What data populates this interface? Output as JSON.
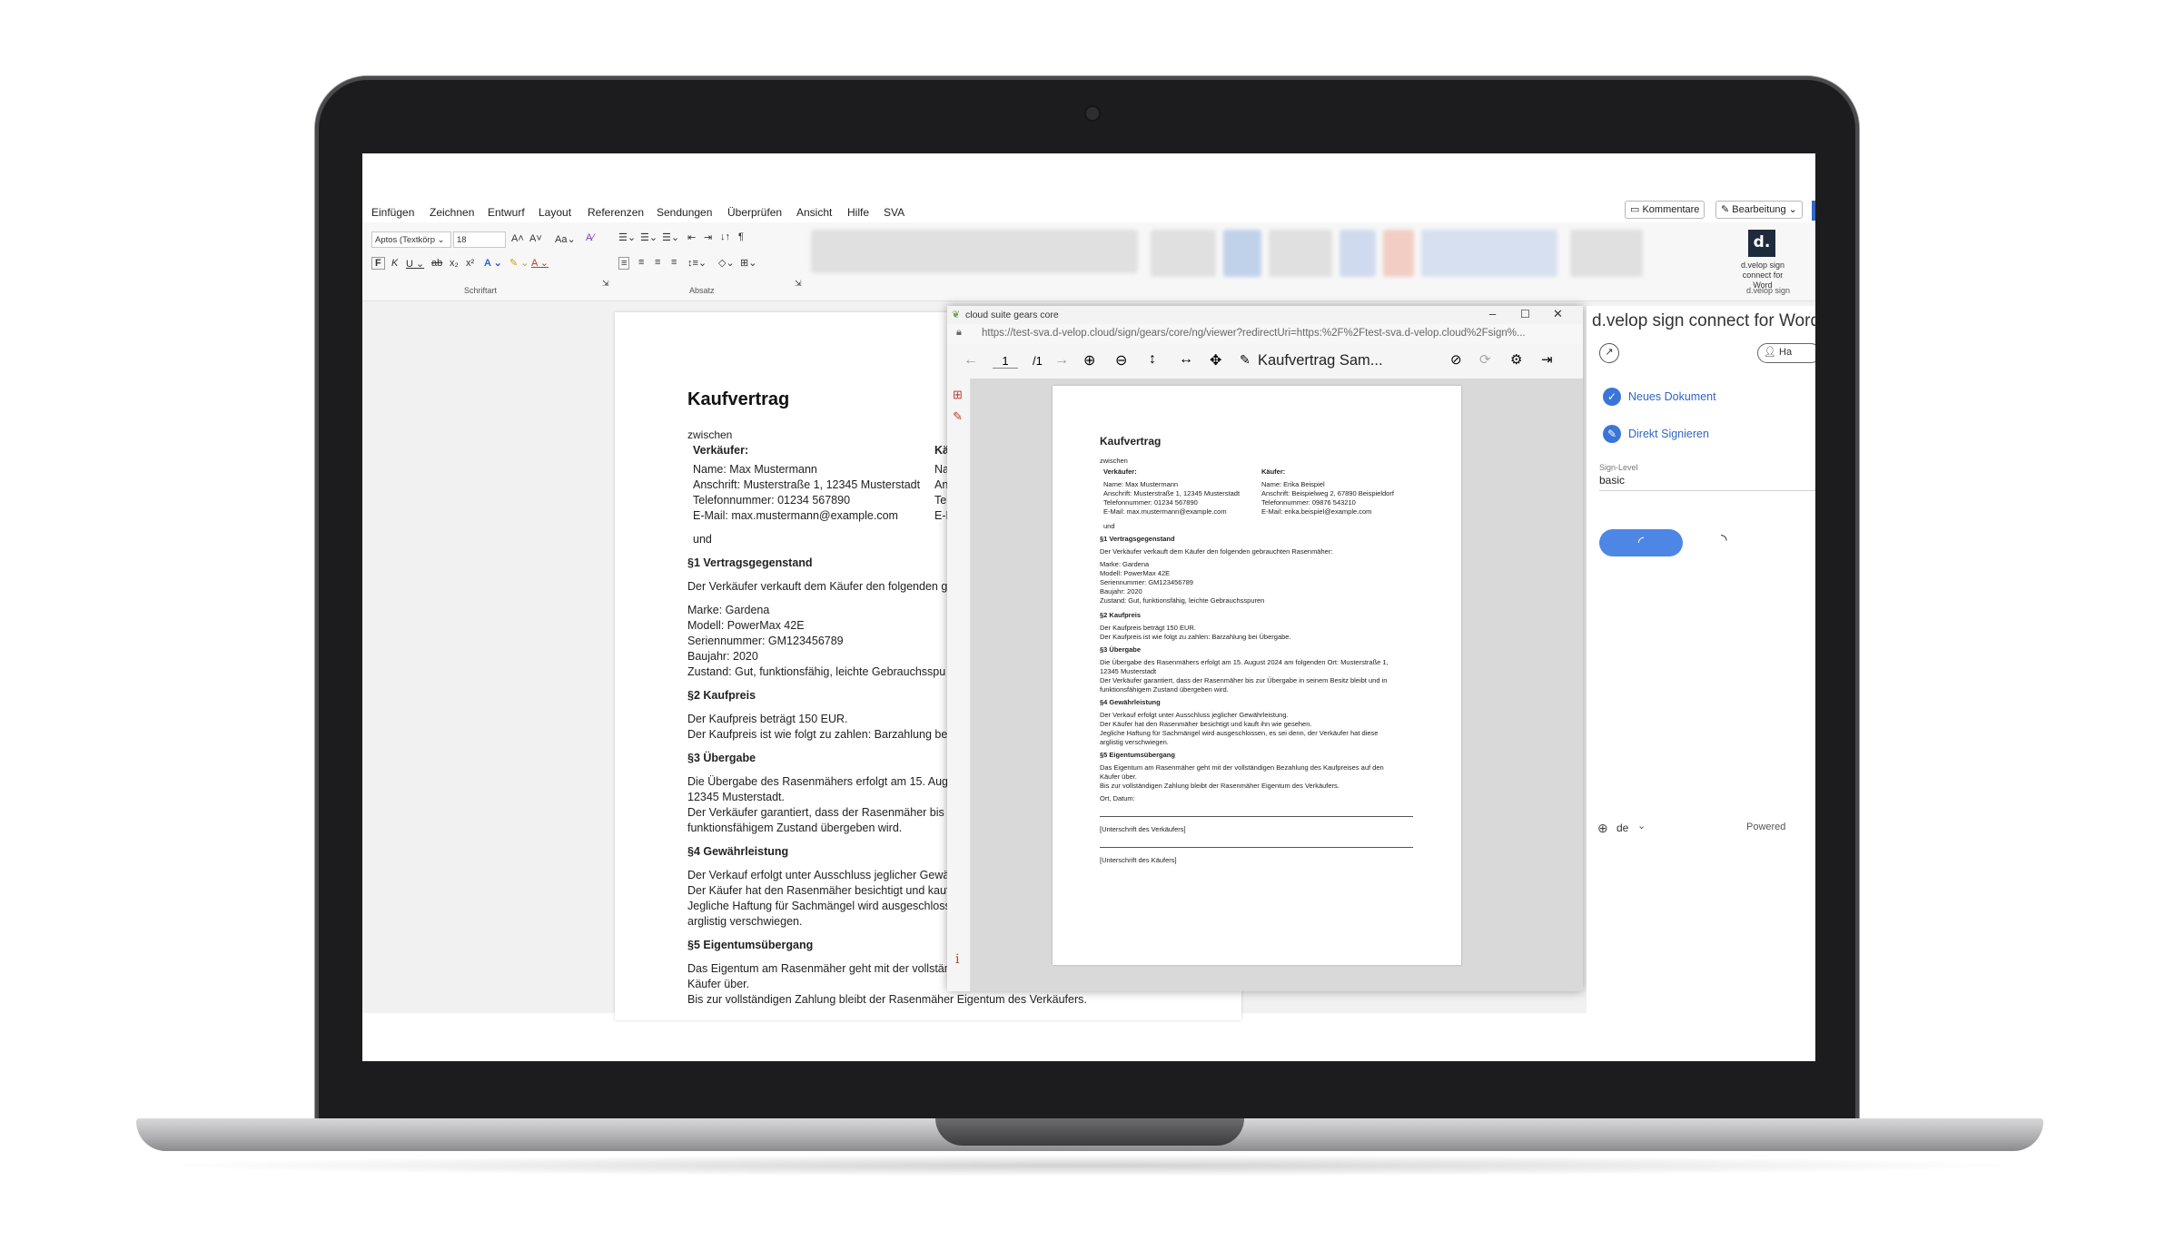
{
  "ribbon": {
    "tabs": [
      "Einfügen",
      "Zeichnen",
      "Entwurf",
      "Layout",
      "Referenzen",
      "Sendungen",
      "Überprüfen",
      "Ansicht",
      "Hilfe",
      "SVA"
    ],
    "font_name": "Aptos (Textkörp",
    "font_size": "18",
    "group_font": "Schriftart",
    "group_paragraph": "Absatz",
    "comments_label": "Kommentare",
    "edit_label": "Bearbeitung",
    "addin_label": "d.velop sign connect for Word",
    "addin_label_line1": "d.velop sign",
    "addin_label_line2": "connect for Word",
    "addin_group": "d.velop sign",
    "logo_text": "d."
  },
  "document": {
    "title": "Kaufvertrag",
    "between": "zwischen",
    "seller_heading": "Verkäufer:",
    "buyer_heading": "Kä",
    "seller_name": "Name: Max Mustermann",
    "seller_address": "Anschrift: Musterstraße 1, 12345 Musterstadt",
    "seller_phone": "Telefonnummer: 01234 567890",
    "seller_email": "E-Mail: max.mustermann@example.com",
    "buyer_cut_1": "Na",
    "buyer_cut_2": "An",
    "buyer_cut_3": "Tel",
    "buyer_cut_4": "E-M",
    "and": "und",
    "s1_title": "§1 Vertragsgegenstand",
    "s1_text": "Der Verkäufer verkauft dem Käufer den folgenden ge",
    "brand": "Marke: Gardena",
    "model": "Modell: PowerMax 42E",
    "serial": "Seriennummer: GM123456789",
    "year": "Baujahr: 2020",
    "condition": "Zustand: Gut, funktionsfähig, leichte Gebrauchsspu",
    "s2_title": "§2 Kaufpreis",
    "s2_line1": "Der Kaufpreis beträgt 150 EUR.",
    "s2_line2": "Der Kaufpreis ist wie folgt zu zahlen: Barzahlung bei",
    "s3_title": "§3 Übergabe",
    "s3_line1": "Die Übergabe des Rasenmähers erfolgt am 15. Augu",
    "s3_line2": "12345 Musterstadt.",
    "s3_line3": "Der Verkäufer garantiert, dass der Rasenmäher bis z",
    "s3_line4": "funktionsfähigem Zustand übergeben wird.",
    "s4_title": "§4 Gewährleistung",
    "s4_line1": "Der Verkauf erfolgt unter Ausschluss jeglicher Gewä",
    "s4_line2": "Der Käufer hat den Rasenmäher besichtigt und kauft",
    "s4_line3": "Jegliche Haftung für Sachmängel wird ausgeschlosse",
    "s4_line4": "arglistig verschwiegen.",
    "s5_title": "§5 Eigentumsübergang",
    "s5_line1": "Das Eigentum am Rasenmäher geht mit der vollstän",
    "s5_line2": "Käufer über.",
    "s5_line3": "Bis zur vollständigen Zahlung bleibt der Rasenmäher Eigentum des Verkäufers."
  },
  "viewer": {
    "window_title": "cloud suite gears core",
    "url": "https://test-sva.d-velop.cloud/sign/gears/core/ng/viewer?redirectUri=https:%2F%2Ftest-sva.d-velop.cloud%2Fsign%...",
    "page_current": "1",
    "page_total": "/1",
    "doc_title": "Kaufvertrag Sam...",
    "info_icon_label": "i",
    "mini": {
      "title": "Kaufvertrag",
      "between": "zwischen",
      "seller_heading": "Verkäufer:",
      "buyer_heading": "Käufer:",
      "seller_name": "Name: Max Mustermann",
      "seller_address": "Anschrift: Musterstraße 1, 12345 Musterstadt",
      "seller_phone": "Telefonnummer: 01234 567890",
      "seller_email": "E-Mail: max.mustermann@example.com",
      "buyer_name": "Name: Erika Beispiel",
      "buyer_address": "Anschrift: Beispielweg 2, 67890 Beispieldorf",
      "buyer_phone": "Telefonnummer: 09876 543210",
      "buyer_email": "E-Mail: erika.beispiel@example.com",
      "and": "und",
      "s1_title": "§1 Vertragsgegenstand",
      "s1_text": "Der Verkäufer verkauft dem Käufer den folgenden gebrauchten Rasenmäher:",
      "brand": "Marke: Gardena",
      "model": "Modell: PowerMax 42E",
      "serial": "Seriennummer: GM123456789",
      "year": "Baujahr: 2020",
      "condition": "Zustand: Gut, funktionsfähig, leichte Gebrauchsspuren",
      "s2_title": "§2 Kaufpreis",
      "s2_line1": "Der Kaufpreis beträgt 150 EUR.",
      "s2_line2": "Der Kaufpreis ist wie folgt zu zahlen: Barzahlung bei Übergabe.",
      "s3_title": "§3 Übergabe",
      "s3_line1": "Die Übergabe des Rasenmähers erfolgt am 15. August 2024 am folgenden Ort: Musterstraße 1,",
      "s3_line2": "12345 Musterstadt",
      "s3_line3": "Der Verkäufer garantiert, dass der Rasenmäher bis zur Übergabe in seinem Besitz bleibt und in",
      "s3_line4": "funktionsfähigem Zustand übergeben wird.",
      "s4_title": "§4 Gewährleistung",
      "s4_line1": "Der Verkauf erfolgt unter Ausschluss jeglicher Gewährleistung.",
      "s4_line2": "Der Käufer hat den Rasenmäher besichtigt und kauft ihn wie gesehen.",
      "s4_line3": "Jegliche Haftung für Sachmängel wird ausgeschlossen, es sei denn, der Verkäufer hat diese",
      "s4_line4": "arglistig verschwiegen.",
      "s5_title": "§5 Eigentumsübergang",
      "s5_line1": "Das Eigentum am Rasenmäher geht mit der vollständigen Bezahlung des Kaufpreises auf den",
      "s5_line2": "Käufer über.",
      "s5_line3": "Bis zur vollständigen Zahlung bleibt der Rasenmäher Eigentum des Verkäufers.",
      "place_date": "Ort, Datum:",
      "sign_seller": "[Unterschrift des Verkäufers]",
      "sign_buyer": "[Unterschrift des Käufers]"
    }
  },
  "panel": {
    "title": "d.velop sign connect for Word",
    "account_btn": "Ha",
    "new_document": "Neues Dokument",
    "sign_directly": "Direkt Signieren",
    "sign_level_label": "Sign-Level",
    "sign_level_value": "basic",
    "language": "de",
    "powered": "Powered"
  },
  "colors": {
    "accent": "#3a75d8",
    "bezel": "#1c1c1e",
    "panel_link": "#2f66c8"
  }
}
